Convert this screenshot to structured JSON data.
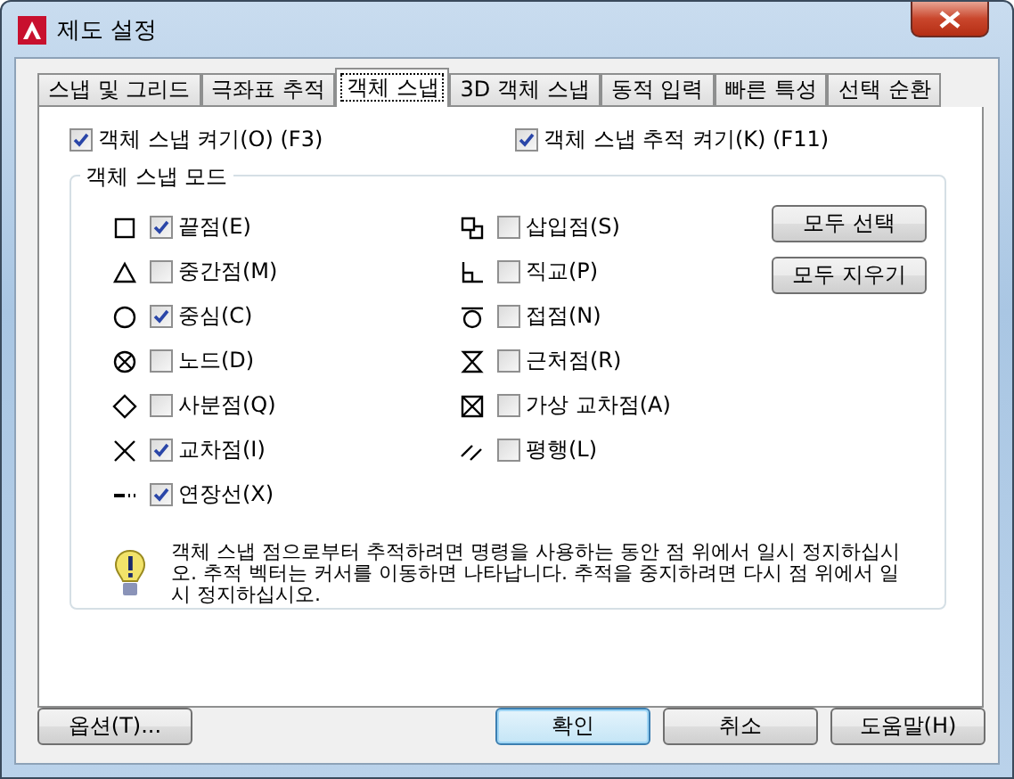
{
  "window": {
    "title": "제도 설정"
  },
  "tabs": [
    {
      "label": "스냅 및 그리드",
      "selected": false
    },
    {
      "label": "극좌표 추적",
      "selected": false
    },
    {
      "label": "객체 스냅",
      "selected": true
    },
    {
      "label": "3D 객체 스냅",
      "selected": false
    },
    {
      "label": "동적 입력",
      "selected": false
    },
    {
      "label": "빠른 특성",
      "selected": false
    },
    {
      "label": "선택 순환",
      "selected": false
    }
  ],
  "toggles": [
    {
      "label": "객체 스냅 켜기(O) (F3)",
      "checked": true
    },
    {
      "label": "객체 스냅 추적 켜기(K) (F11)",
      "checked": true
    }
  ],
  "group": {
    "title": "객체 스냅 모드",
    "left_modes": [
      {
        "label": "끝점(E)",
        "checked": true
      },
      {
        "label": "중간점(M)",
        "checked": false
      },
      {
        "label": "중심(C)",
        "checked": true
      },
      {
        "label": "노드(D)",
        "checked": false
      },
      {
        "label": "사분점(Q)",
        "checked": false
      },
      {
        "label": "교차점(I)",
        "checked": true
      },
      {
        "label": "연장선(X)",
        "checked": true
      }
    ],
    "right_modes": [
      {
        "label": "삽입점(S)",
        "checked": false
      },
      {
        "label": "직교(P)",
        "checked": false
      },
      {
        "label": "접점(N)",
        "checked": false
      },
      {
        "label": "근처점(R)",
        "checked": false
      },
      {
        "label": "가상 교차점(A)",
        "checked": false
      },
      {
        "label": "평행(L)",
        "checked": false
      }
    ],
    "buttons": [
      "모두 선택",
      "모두 지우기"
    ],
    "hint": "객체 스냅 점으로부터 추적하려면 명령을 사용하는 동안 점 위에서 일시 정지하십시오. 추적 벡터는 커서를 이동하면 나타납니다. 추적을 중지하려면 다시 점 위에서 일시 정지하십시오."
  },
  "footer": {
    "options_button": "옵션(T)...",
    "buttons": [
      {
        "label": "확인",
        "default": true
      },
      {
        "label": "취소",
        "default": false
      },
      {
        "label": "도움말(H)",
        "default": false
      }
    ]
  }
}
